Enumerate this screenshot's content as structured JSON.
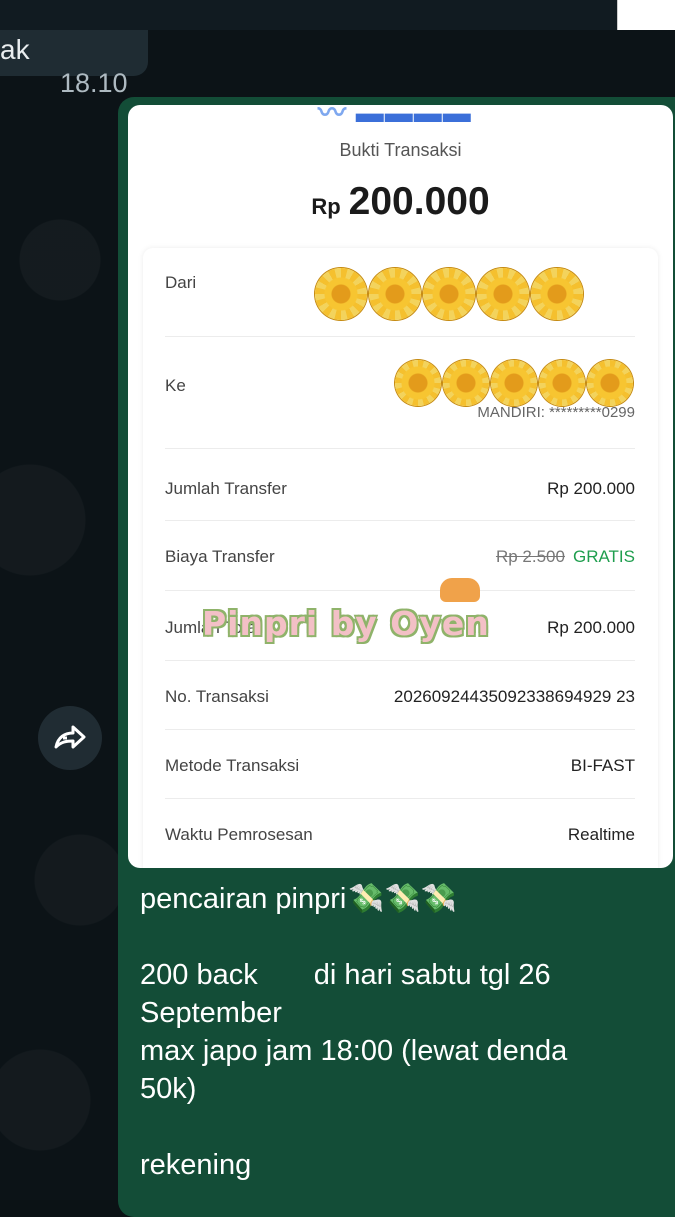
{
  "chat": {
    "prev_message_fragment": "ak",
    "prev_message_time": "18.10",
    "forward_icon": "forward-icon"
  },
  "receipt": {
    "title": "Bukti Transaksi",
    "amount_currency": "Rp",
    "amount_value": "200.000",
    "rows": [
      {
        "label": "Dari",
        "value": "",
        "sub": ""
      },
      {
        "label": "Ke",
        "value": "",
        "sub": "MANDIRI: *********0299"
      },
      {
        "label": "Jumlah Transfer",
        "value": "Rp 200.000"
      },
      {
        "label": "Biaya Transfer",
        "value_old": "Rp 2.500",
        "value": "GRATIS"
      },
      {
        "label": "Jumlah Total",
        "value": "Rp 200.000"
      },
      {
        "label": "No. Transaksi",
        "value": "20260924435092338694929 23"
      },
      {
        "label": "Metode Transaksi",
        "value": "BI-FAST"
      },
      {
        "label": "Waktu Pemrosesan",
        "value": "Realtime"
      }
    ],
    "colors": {
      "accent_green": "#1f9e4e",
      "bubble": "#134d37"
    }
  },
  "watermark": {
    "text": "Pinpri by Oyen"
  },
  "message": {
    "line1": "pencairan pinpri",
    "line2a": "200 back",
    "line2b": "di hari sabtu tgl 26",
    "line3": "September",
    "line4": "max japo jam 18:00 (lewat denda",
    "line5": "50k)",
    "line6": "rekening"
  }
}
